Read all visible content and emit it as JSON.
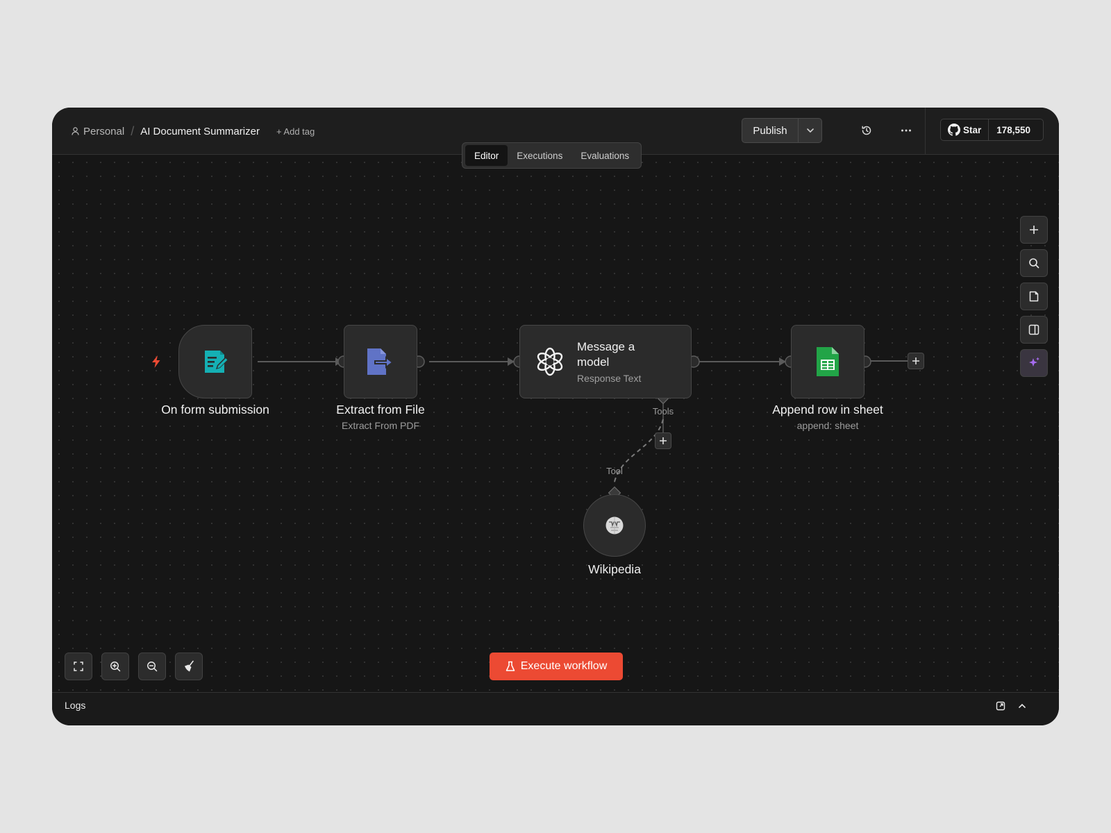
{
  "header": {
    "project": "Personal",
    "separator": "/",
    "workflow_name": "AI Document Summarizer",
    "add_tag": "+ Add tag",
    "publish_label": "Publish",
    "github_star": "Star",
    "github_count": "178,550"
  },
  "tabs": [
    {
      "label": "Editor",
      "active": true
    },
    {
      "label": "Executions",
      "active": false
    },
    {
      "label": "Evaluations",
      "active": false
    }
  ],
  "nodes": {
    "trigger": {
      "label": "On form submission",
      "icon": "form-icon"
    },
    "extract": {
      "label": "Extract from File",
      "subtitle": "Extract From PDF",
      "icon": "file-extract-icon"
    },
    "model": {
      "title": "Message a model",
      "subtitle": "Response Text",
      "icon": "openai-icon"
    },
    "sheet": {
      "label": "Append row in sheet",
      "subtitle": "append: sheet",
      "icon": "google-sheets-icon"
    },
    "wiki": {
      "label": "Wikipedia",
      "icon": "wikipedia-icon"
    }
  },
  "connections": {
    "tools_label": "Tools",
    "tool_label": "Tool"
  },
  "execute_label": "Execute workflow",
  "logs_label": "Logs",
  "colors": {
    "accent": "#ec4a33",
    "form": "#15b0b4",
    "extract": "#6073c6",
    "sheets": "#22a447",
    "ai": "#a76cf0"
  }
}
